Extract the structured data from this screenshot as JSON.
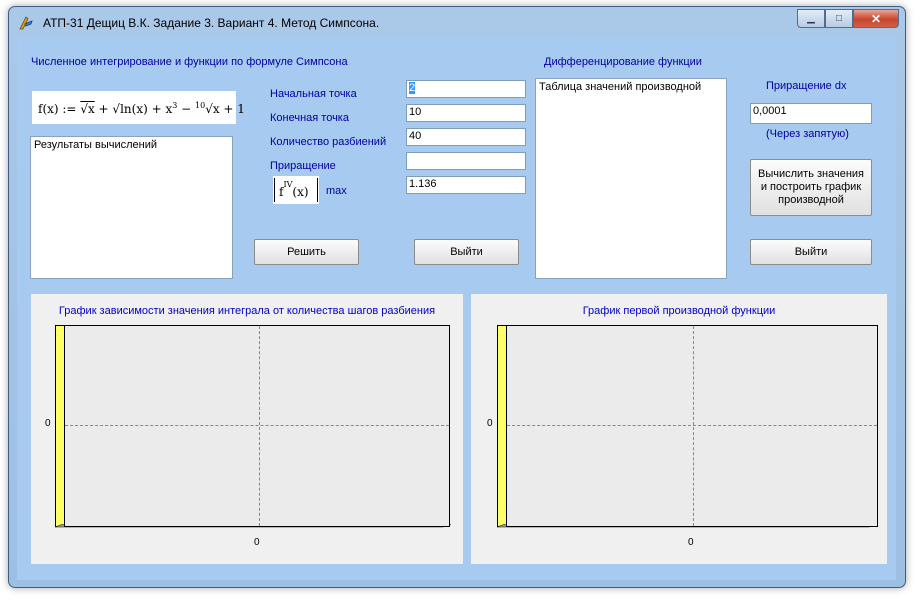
{
  "window": {
    "title": "АТП-31 Дещиц В.К. Задание 3. Вариант 4. Метод Симпсона.",
    "minimize": "▁",
    "maximize": "□",
    "close": "✕"
  },
  "integration": {
    "section_title": "Численное интегрирование и функции по формуле Симпсона",
    "formula": "f(x) := √x + √ln(x) + x³ − ¹⁰√x + 1",
    "results_memo": "Результаты вычислений",
    "start_label": "Начальная точка",
    "start_value": "2",
    "end_label": "Конечная точка",
    "end_value": "10",
    "partitions_label": "Количество разбиений",
    "partitions_value": "40",
    "increment_label": "Приращение",
    "increment_value": "",
    "max_label": "max",
    "max_value": "1.136",
    "f4_label": "f IV (x)",
    "solve_button": "Решить",
    "exit_button": "Выйти"
  },
  "differentiation": {
    "section_title": "Дифференцирование функции",
    "table_memo": "Таблица значений производной",
    "dx_label": "Приращение dx",
    "dx_value": "0,0001",
    "dx_hint": "(Через запятую)",
    "compute_button": "Вычислить значения и построить график производной",
    "exit_button": "Выйти"
  },
  "charts": [
    {
      "title": "График зависимости значения интеграла от количества шагов разбиения",
      "x_tick": "0",
      "y_tick": "0"
    },
    {
      "title": "График первой производной функции",
      "x_tick": "0",
      "y_tick": "0"
    }
  ],
  "chart_data": [
    {
      "type": "line",
      "title": "График зависимости значения интеграла от количества шагов разбиения",
      "series": [],
      "x_ticks": [
        "0"
      ],
      "y_ticks": [
        "0"
      ],
      "grid": true
    },
    {
      "type": "line",
      "title": "График первой производной функции",
      "series": [],
      "x_ticks": [
        "0"
      ],
      "y_ticks": [
        "0"
      ],
      "grid": true
    }
  ],
  "colors": {
    "client_bg": "#a6caf0",
    "label_blue": "#0000a0",
    "chart_wall": "#ffff66"
  }
}
